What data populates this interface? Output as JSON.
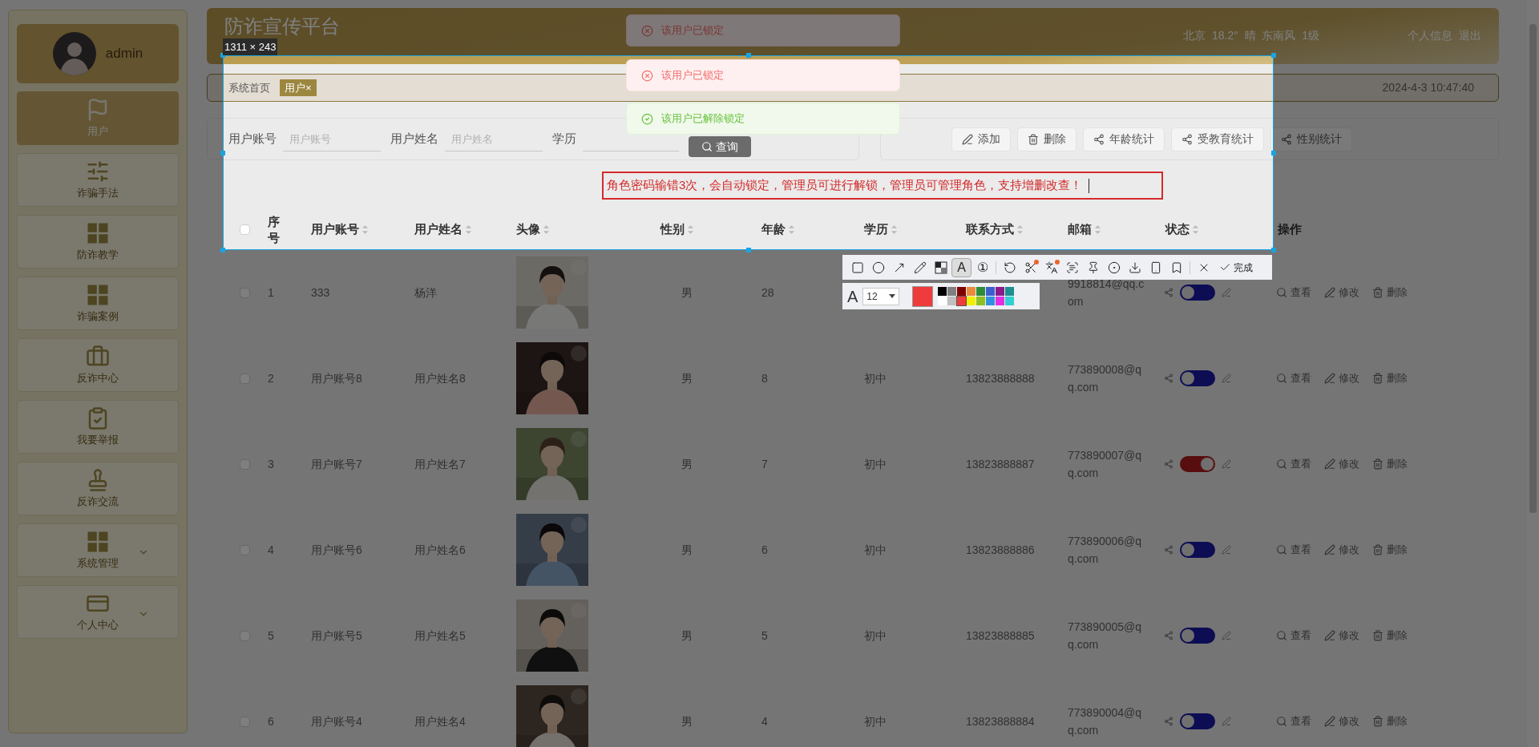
{
  "sidebar": {
    "user": {
      "name": "admin"
    },
    "items": [
      {
        "label": "用户",
        "selected": true,
        "expandable": false
      },
      {
        "label": "诈骗手法",
        "selected": false,
        "expandable": false
      },
      {
        "label": "防诈教学",
        "selected": false,
        "expandable": false
      },
      {
        "label": "诈骗案例",
        "selected": false,
        "expandable": false
      },
      {
        "label": "反诈中心",
        "selected": false,
        "expandable": false
      },
      {
        "label": "我要举报",
        "selected": false,
        "expandable": false
      },
      {
        "label": "反诈交流",
        "selected": false,
        "expandable": false
      },
      {
        "label": "系统管理",
        "selected": false,
        "expandable": true
      },
      {
        "label": "个人中心",
        "selected": false,
        "expandable": true
      }
    ]
  },
  "header": {
    "title": "防诈宣传平台",
    "weather": "北京  18.2°  晴  东南风  1级",
    "links": [
      "个人信息",
      "退出"
    ]
  },
  "breadcrumb": {
    "home": "系统首页",
    "tabs": [
      {
        "label": "用户×",
        "selected": true
      }
    ],
    "datetime": "2024-4-3 10:47:40"
  },
  "search": {
    "fields": [
      {
        "kind": "input",
        "label": "用户账号",
        "placeholder": "用户账号"
      },
      {
        "kind": "input",
        "label": "用户姓名",
        "placeholder": "用户姓名"
      },
      {
        "kind": "select",
        "label": "学历"
      }
    ],
    "button": "查询"
  },
  "actions": [
    "添加",
    "删除",
    "年龄统计",
    "受教育统计",
    "性别统计"
  ],
  "toasts": [
    {
      "kind": "error",
      "text": "该用户已锁定"
    },
    {
      "kind": "error",
      "text": "该用户已锁定"
    },
    {
      "kind": "success",
      "text": "该用户已解除锁定"
    }
  ],
  "table": {
    "header_checkbox": {
      "checked": false
    },
    "columns": [
      "序号",
      "用户账号",
      "用户姓名",
      "头像",
      "性别",
      "年龄",
      "学历",
      "联系方式",
      "邮箱",
      "状态",
      "操作"
    ],
    "rows": [
      {
        "checked": false,
        "index": "1",
        "account": "333",
        "name": "杨洋",
        "gender": "男",
        "age": "28",
        "email": "9918814@qq.com",
        "locked": false,
        "actions": [
          "查看",
          "修改",
          "删除"
        ]
      },
      {
        "checked": false,
        "index": "2",
        "account": "用户账号8",
        "name": "用户姓名8",
        "gender": "男",
        "age": "8",
        "education": "初中",
        "phone": "13823888888",
        "email": "773890008@qq.com",
        "locked": false,
        "actions": [
          "查看",
          "修改",
          "删除"
        ]
      },
      {
        "checked": false,
        "index": "3",
        "account": "用户账号7",
        "name": "用户姓名7",
        "gender": "男",
        "age": "7",
        "education": "初中",
        "phone": "13823888887",
        "email": "773890007@qq.com",
        "locked": true,
        "actions": [
          "查看",
          "修改",
          "删除"
        ]
      },
      {
        "checked": false,
        "index": "4",
        "account": "用户账号6",
        "name": "用户姓名6",
        "gender": "男",
        "age": "6",
        "education": "初中",
        "phone": "13823888886",
        "email": "773890006@qq.com",
        "locked": false,
        "actions": [
          "查看",
          "修改",
          "删除"
        ]
      },
      {
        "checked": false,
        "index": "5",
        "account": "用户账号5",
        "name": "用户姓名5",
        "gender": "男",
        "age": "5",
        "education": "初中",
        "phone": "13823888885",
        "email": "773890005@qq.com",
        "locked": false,
        "actions": [
          "查看",
          "修改",
          "删除"
        ]
      },
      {
        "checked": false,
        "index": "6",
        "account": "用户账号4",
        "name": "用户姓名4",
        "gender": "男",
        "age": "4",
        "education": "初中",
        "phone": "13823888884",
        "email": "773890004@qq.com",
        "locked": false,
        "actions": [
          "查看",
          "修改",
          "删除"
        ]
      }
    ]
  },
  "capture": {
    "size": "1311 × 243",
    "annotation": "角色密码输错3次，会自动锁定，管理员可进行解锁，管理员可管理角色，支持增删改查！",
    "tools": [
      {
        "selected": false,
        "badge": false
      },
      {
        "selected": false,
        "badge": false
      },
      {
        "selected": false,
        "badge": false
      },
      {
        "selected": false,
        "badge": false
      },
      {
        "selected": false,
        "badge": false
      },
      {
        "glyph": "A",
        "selected": true,
        "badge": false
      },
      {
        "glyph": "①",
        "selected": false,
        "badge": false
      },
      {
        "selected": false,
        "badge": false
      },
      {
        "selected": false,
        "badge": true
      },
      {
        "selected": false,
        "badge": true
      },
      {
        "selected": false,
        "badge": false
      },
      {
        "selected": false,
        "badge": false
      },
      {
        "selected": false,
        "badge": false
      },
      {
        "selected": false,
        "badge": false
      },
      {
        "selected": false,
        "badge": false
      },
      {
        "selected": false,
        "badge": false
      },
      {
        "selected": false,
        "badge": false
      }
    ],
    "done": "完成",
    "font_glyph": "A",
    "font_size": "12",
    "palette": [
      {
        "color": "#000000",
        "selected": false
      },
      {
        "color": "#808080",
        "selected": false
      },
      {
        "color": "#800000",
        "selected": false
      },
      {
        "color": "#e98b3a",
        "selected": false
      },
      {
        "color": "#2e8b3a",
        "selected": false
      },
      {
        "color": "#3c5fd0",
        "selected": false
      },
      {
        "color": "#8b1a8b",
        "selected": false
      },
      {
        "color": "#1a9090",
        "selected": false
      },
      {
        "color": "#ffffff",
        "selected": false
      },
      {
        "color": "#c0c0c0",
        "selected": false
      },
      {
        "color": "#ee3b3b",
        "selected": true
      },
      {
        "color": "#f0f000",
        "selected": false
      },
      {
        "color": "#90c020",
        "selected": false
      },
      {
        "color": "#3090e0",
        "selected": false
      },
      {
        "color": "#e030e0",
        "selected": false
      },
      {
        "color": "#30d0d0",
        "selected": false
      }
    ]
  }
}
